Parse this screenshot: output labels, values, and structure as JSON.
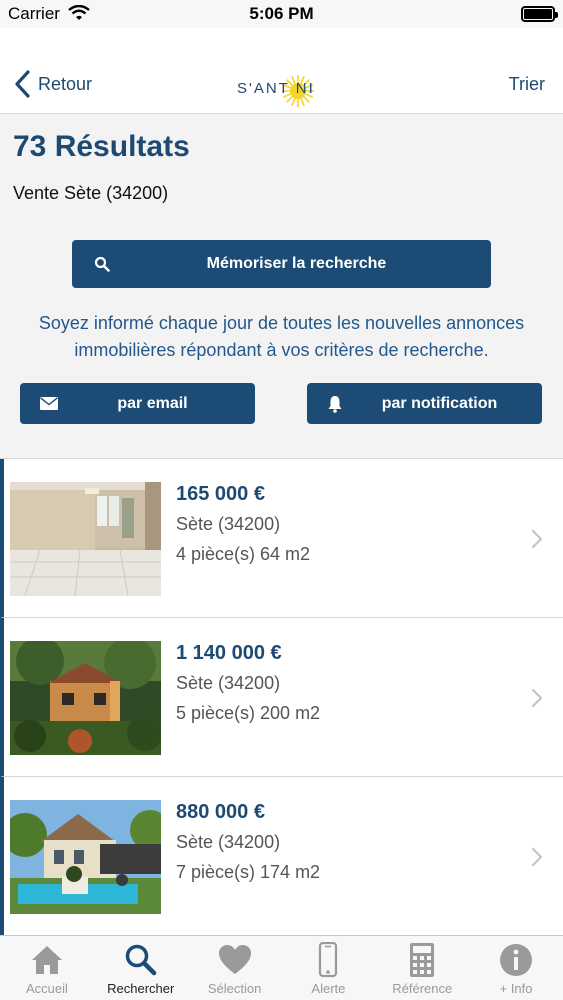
{
  "status_bar": {
    "carrier": "Carrier",
    "time": "5:06 PM"
  },
  "nav": {
    "back_label": "Retour",
    "logo_text": "S'ANT  NI",
    "sort_label": "Trier"
  },
  "results": {
    "title": "73 Résultats",
    "subtitle": "Vente Sète (34200)"
  },
  "save_search": {
    "label": "Mémoriser la recherche"
  },
  "info": {
    "line1": "Soyez informé chaque jour de toutes les nouvelles annonces",
    "line2": "immobilières répondant à vos critères de recherche."
  },
  "alerts": {
    "email_label": "par email",
    "notification_label": "par notification"
  },
  "listings": [
    {
      "price": "165 000  €",
      "location": "Sète (34200)",
      "details": "4 pièce(s) 64 m2"
    },
    {
      "price": "1 140 000  €",
      "location": "Sète (34200)",
      "details": "5 pièce(s) 200 m2"
    },
    {
      "price": "880 000  €",
      "location": "Sète (34200)",
      "details": "7 pièce(s) 174 m2"
    }
  ],
  "tabs": [
    {
      "label": "Accueil",
      "icon": "home-icon"
    },
    {
      "label": "Rechercher",
      "icon": "search-icon",
      "active": true
    },
    {
      "label": "Sélection",
      "icon": "heart-icon"
    },
    {
      "label": "Alerte",
      "icon": "phone-icon"
    },
    {
      "label": "Référence",
      "icon": "calculator-icon"
    },
    {
      "label": "+ Info",
      "icon": "info-icon"
    }
  ],
  "colors": {
    "brand": "#1c4b75",
    "link": "#24578a",
    "sun": "#f5d327"
  }
}
